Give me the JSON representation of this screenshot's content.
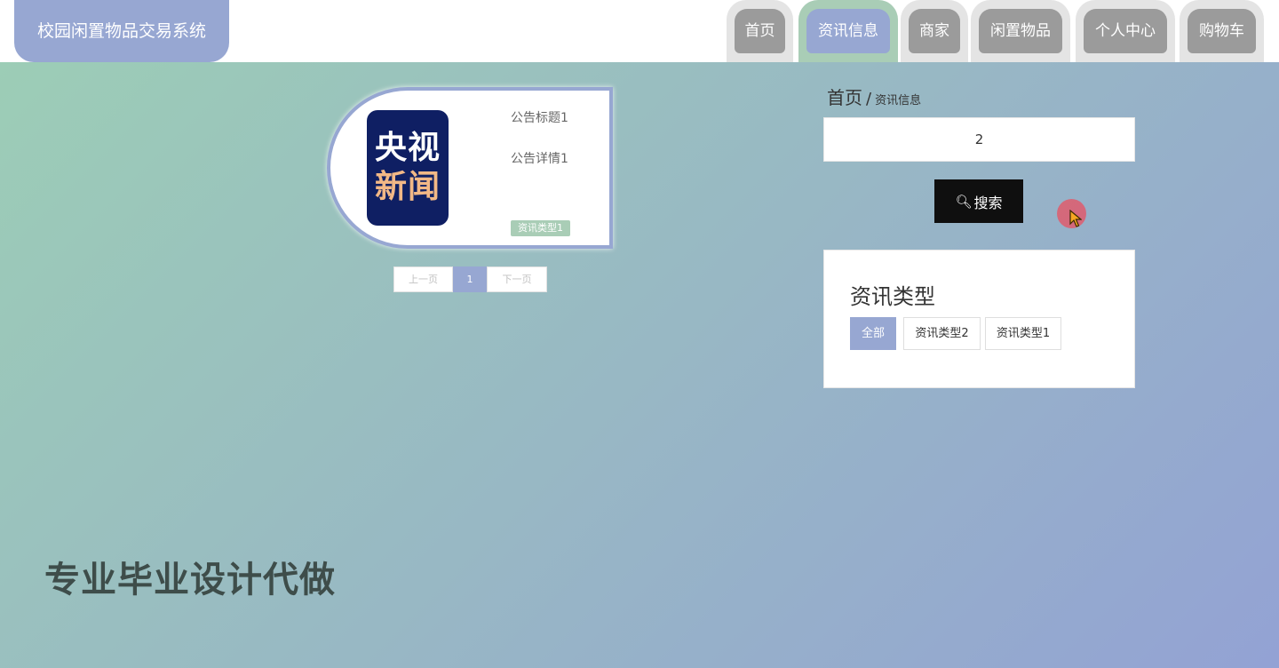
{
  "header": {
    "site_title": "校园闲置物品交易系统",
    "nav": [
      {
        "label": "首页",
        "active": false
      },
      {
        "label": "资讯信息",
        "active": true
      },
      {
        "label": "商家",
        "active": false
      },
      {
        "label": "闲置物品",
        "active": false
      },
      {
        "label": "个人中心",
        "active": false
      },
      {
        "label": "购物车",
        "active": false
      }
    ]
  },
  "news_card": {
    "logo_line1": "央视",
    "logo_line2": "新闻",
    "title": "公告标题1",
    "detail": "公告详情1",
    "type_tag": "资讯类型1"
  },
  "pagination": {
    "prev_label": "上一页",
    "current_page": "1",
    "next_label": "下一页"
  },
  "breadcrumb": {
    "home": "首页",
    "separator": "/",
    "current": "资讯信息"
  },
  "search": {
    "input_value": "2",
    "button_label": "搜索"
  },
  "types_panel": {
    "title": "资讯类型",
    "chips": [
      {
        "label": "全部",
        "selected": true
      },
      {
        "label": "资讯类型2",
        "selected": false
      },
      {
        "label": "资讯类型1",
        "selected": false
      }
    ]
  },
  "watermark_text": "专业毕业设计代做",
  "colors": {
    "accent_blue": "#97a7d2",
    "accent_green": "#a9cdb6",
    "nav_gray": "#9b9b9b",
    "search_button": "#0f0f0f"
  }
}
